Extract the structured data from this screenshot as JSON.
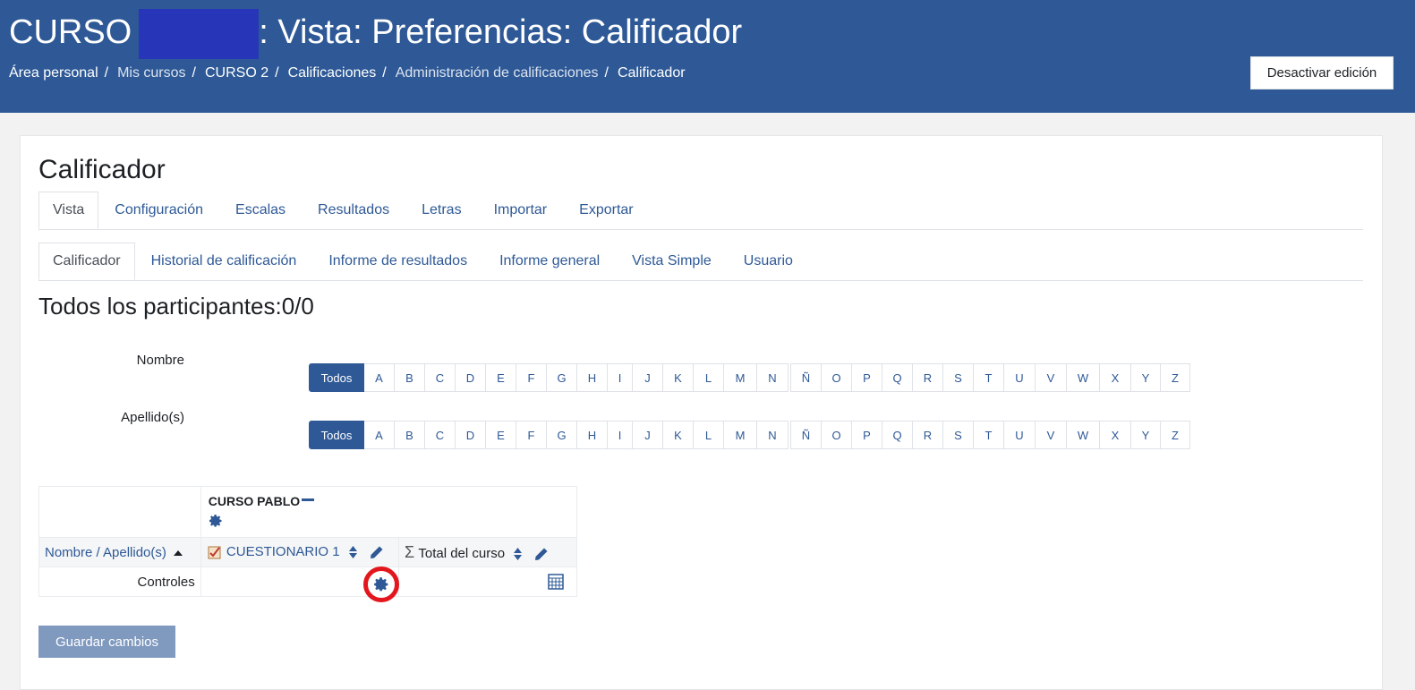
{
  "header": {
    "title_prefix": "CURSO",
    "title_suffix": ": Vista: Preferencias: Calificador",
    "breadcrumb": [
      {
        "label": "Área personal"
      },
      {
        "label": "Mis cursos"
      },
      {
        "label": "CURSO 2"
      },
      {
        "label": "Calificaciones"
      },
      {
        "label": "Administración de calificaciones"
      },
      {
        "label": "Calificador"
      }
    ],
    "edit_button": "Desactivar edición"
  },
  "main": {
    "title": "Calificador",
    "tabs_primary": [
      "Vista",
      "Configuración",
      "Escalas",
      "Resultados",
      "Letras",
      "Importar",
      "Exportar"
    ],
    "tabs_secondary": [
      "Calificador",
      "Historial de calificación",
      "Informe de resultados",
      "Informe general",
      "Vista Simple",
      "Usuario"
    ],
    "participants": "Todos los participantes:0/0",
    "filter_first_label": "Nombre",
    "filter_last_label": "Apellido(s)",
    "all_label": "Todos",
    "letters_a": [
      "A",
      "B",
      "C",
      "D",
      "E",
      "F",
      "G",
      "H",
      "I",
      "J",
      "K",
      "L",
      "M",
      "N"
    ],
    "letters_b": [
      "Ñ",
      "O",
      "P",
      "Q",
      "R",
      "S",
      "T",
      "U",
      "V",
      "W",
      "X",
      "Y",
      "Z"
    ]
  },
  "grader": {
    "course_name": "CURSO PABLO",
    "col_user": "Nombre / Apellido(s)",
    "col_item": "CUESTIONARIO 1",
    "col_total": "Total del curso",
    "controls_label": "Controles"
  },
  "save_button": "Guardar cambios",
  "colors": {
    "header_bg": "#2e5996",
    "link": "#2e5996",
    "highlight_ring": "#e3151d"
  }
}
